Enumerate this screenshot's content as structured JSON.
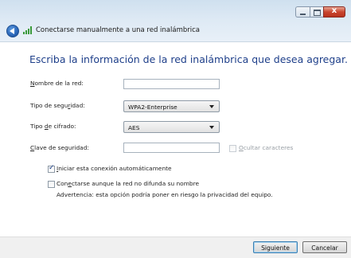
{
  "window": {
    "title": "Conectarse manualmente a una red inalámbrica",
    "close_glyph": "x"
  },
  "heading": "Escriba la información de la red inalámbrica que desea agregar.",
  "form": {
    "network_name": {
      "label_pre": "",
      "label_u": "N",
      "label_post": "ombre de la red:",
      "value": ""
    },
    "security_type": {
      "label_pre": "Tipo de segu",
      "label_u": "r",
      "label_post": "idad:",
      "value": "WPA2-Enterprise"
    },
    "encryption_type": {
      "label_pre": "Tipo ",
      "label_u": "d",
      "label_post": "e cifrado:",
      "value": "AES"
    },
    "security_key": {
      "label_pre": "",
      "label_u": "C",
      "label_post": "lave de seguridad:",
      "value": ""
    },
    "hide_chars": {
      "label_pre": "",
      "label_u": "O",
      "label_post": "cultar caracteres",
      "checked": false,
      "enabled": false
    }
  },
  "options": {
    "auto_start": {
      "label_pre": "",
      "label_u": "I",
      "label_post": "niciar esta conexión automáticamente",
      "checked": true
    },
    "connect_hidden": {
      "label_pre": "Con",
      "label_u": "e",
      "label_post": "ctarse aunque la red no difunda su nombre",
      "checked": false
    },
    "warning": "Advertencia: esta opción podría poner en riesgo la privacidad del equipo."
  },
  "buttons": {
    "next": "Siguiente",
    "cancel": "Cancelar"
  },
  "colors": {
    "heading": "#1e3f8a",
    "titlebar": "#dde9f4",
    "close_button": "#c9462f"
  },
  "icons": {
    "back": "back-arrow-icon",
    "network": "wireless-signal-icon"
  }
}
